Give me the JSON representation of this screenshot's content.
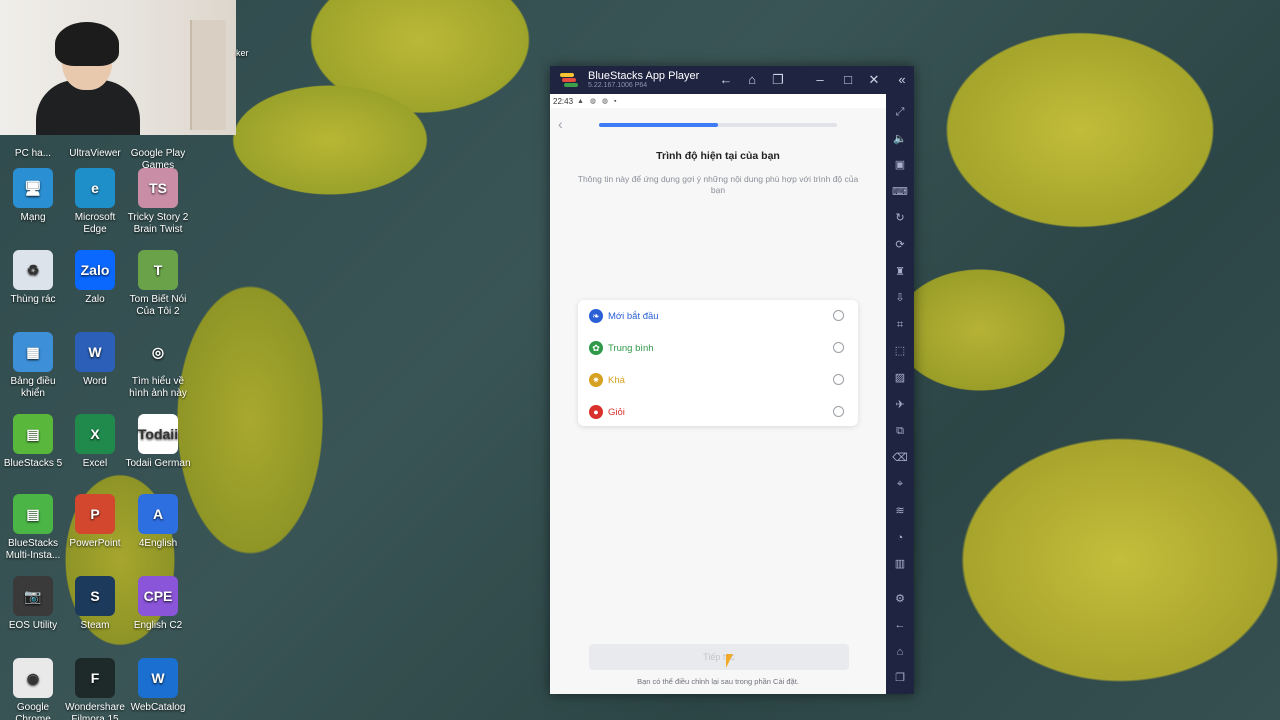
{
  "desktop": {
    "icons": [
      {
        "label": "PC ha...",
        "color": "#3b6bd6",
        "glyph": "PC"
      },
      {
        "label": "UltraViewer",
        "color": "#1c75c4",
        "glyph": "U"
      },
      {
        "label": "Google Play Games",
        "color": "#2a2a2a",
        "glyph": "▶"
      },
      {
        "label": "Mạng",
        "color": "#2b8fd3",
        "glyph": "🖥"
      },
      {
        "label": "Microsoft Edge",
        "color": "#1e8fc9",
        "glyph": "e"
      },
      {
        "label": "Tricky Story 2 Brain Twist",
        "color": "#c98ea6",
        "glyph": "TS"
      },
      {
        "label": "Thùng rác",
        "color": "#dde3ea",
        "glyph": "♻"
      },
      {
        "label": "Zalo",
        "color": "#0a68ff",
        "glyph": "Zalo"
      },
      {
        "label": "Tom Biết Nói Của Tôi 2",
        "color": "#6aa24a",
        "glyph": "T"
      },
      {
        "label": "Bảng điều khiển",
        "color": "#3d8fd8",
        "glyph": "▦"
      },
      {
        "label": "Word",
        "color": "#2b5fb8",
        "glyph": "W"
      },
      {
        "label": "Tìm hiểu về hình ảnh này",
        "color": "transparent",
        "glyph": "◎"
      },
      {
        "label": "BlueStacks 5",
        "color": "#59b83c",
        "glyph": "▤"
      },
      {
        "label": "Excel",
        "color": "#1f8a4c",
        "glyph": "X"
      },
      {
        "label": "Todaii German",
        "color": "#ffffff",
        "glyph": "Todaii"
      },
      {
        "label": "BlueStacks Multi-Insta...",
        "color": "#4bb546",
        "glyph": "▤"
      },
      {
        "label": "PowerPoint",
        "color": "#d2472e",
        "glyph": "P"
      },
      {
        "label": "4English",
        "color": "#2d6ee0",
        "glyph": "A"
      },
      {
        "label": "EOS Utility",
        "color": "#3a3a3a",
        "glyph": "📷"
      },
      {
        "label": "Steam",
        "color": "#1c3a5c",
        "glyph": "S"
      },
      {
        "label": "English C2",
        "color": "#8a55d8",
        "glyph": "CPE"
      },
      {
        "label": "Google Chrome",
        "color": "#e9e9e9",
        "glyph": "◉"
      },
      {
        "label": "Wondershare Filmora 15",
        "color": "#1e2a2a",
        "glyph": "F"
      },
      {
        "label": "WebCatalog",
        "color": "#1a6fd1",
        "glyph": "W"
      }
    ],
    "webcam_label": "ker"
  },
  "bluestacks": {
    "title": "BlueStacks App Player",
    "version": "5.22.167.1006  P64",
    "titlebar_buttons": [
      "back-icon",
      "home-icon",
      "multi-instance-icon",
      "minimize-icon",
      "maximize-icon",
      "close-icon",
      "collapse-sidebar-icon"
    ]
  },
  "android": {
    "statusbar": {
      "time": "22:43",
      "icons": "▲ ◍ ◍ ▪"
    },
    "progress_fraction": 0.5,
    "title": "Trình độ hiện tại của bạn",
    "subtitle": "Thông tin này để ứng dụng gợi ý những nội dung phù hợp với trình độ của bạn",
    "options": [
      {
        "label": "Mới bắt đầu",
        "color": "#2a5fd6",
        "icon": "leaf-icon",
        "glyph": "❧"
      },
      {
        "label": "Trung bình",
        "color": "#2f9a4a",
        "icon": "sprout-icon",
        "glyph": "✿"
      },
      {
        "label": "Khá",
        "color": "#d6a021",
        "icon": "gear-icon",
        "glyph": "✷"
      },
      {
        "label": "Giỏi",
        "color": "#d9312b",
        "icon": "apple-icon",
        "glyph": "●"
      }
    ],
    "next_button": "Tiếp tục",
    "footer_note": "Bạn có thể điều chỉnh lại sau trong phần Cài đặt."
  }
}
